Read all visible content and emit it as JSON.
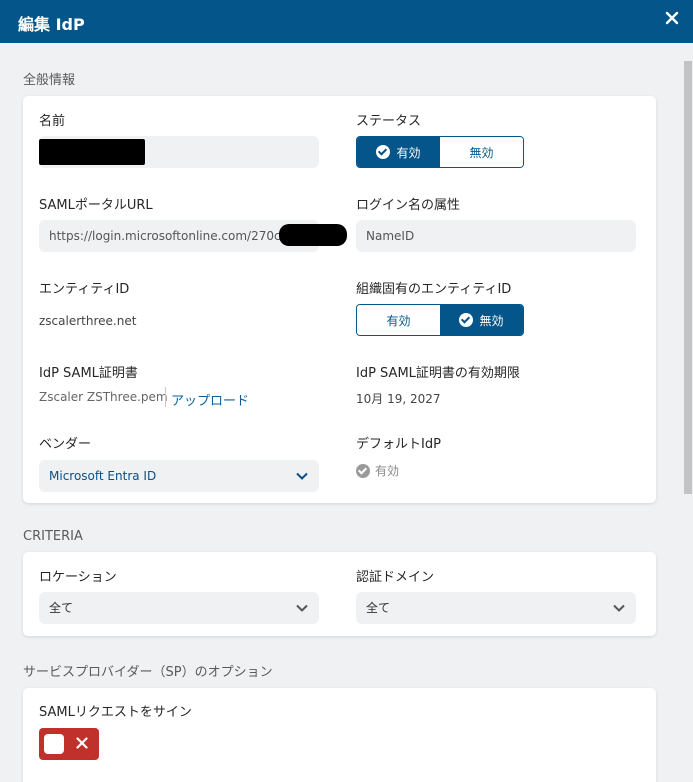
{
  "header": {
    "title": "編集 IdP"
  },
  "general": {
    "section_title": "全般情報",
    "name": {
      "label": "名前",
      "value": ""
    },
    "status": {
      "label": "ステータス",
      "options": [
        "有効",
        "無効"
      ],
      "selected": "有効"
    },
    "saml_portal_url": {
      "label": "SAMLポータルURL",
      "value": "https://login.microsoftonline.com/270cc3d"
    },
    "login_attribute": {
      "label": "ログイン名の属性",
      "value": "NameID"
    },
    "entity_id": {
      "label": "エンティティID",
      "value": "zscalerthree.net"
    },
    "org_entity_id": {
      "label": "組織固有のエンティティID",
      "options": [
        "有効",
        "無効"
      ],
      "selected": "無効"
    },
    "idp_cert": {
      "label": "IdP SAML証明書",
      "file": "Zscaler ZSThree.pem",
      "upload_label": "アップロード"
    },
    "cert_expiry": {
      "label": "IdP SAML証明書の有効期限",
      "value": "10月 19, 2027"
    },
    "vendor": {
      "label": "ベンダー",
      "value": "Microsoft Entra ID"
    },
    "default_idp": {
      "label": "デフォルトIdP",
      "value": "有効"
    }
  },
  "criteria": {
    "section_title": "CRITERIA",
    "location": {
      "label": "ロケーション",
      "value": "全て"
    },
    "auth_domain": {
      "label": "認証ドメイン",
      "value": "全て"
    }
  },
  "sp_options": {
    "section_title": "サービスプロバイダー（SP）のオプション",
    "sign_request": {
      "label": "SAMLリクエストをサイン",
      "enabled": false
    }
  },
  "colors": {
    "header_bg": "#04568a",
    "accent": "#04568a",
    "toggle_off": "#c0312b"
  }
}
